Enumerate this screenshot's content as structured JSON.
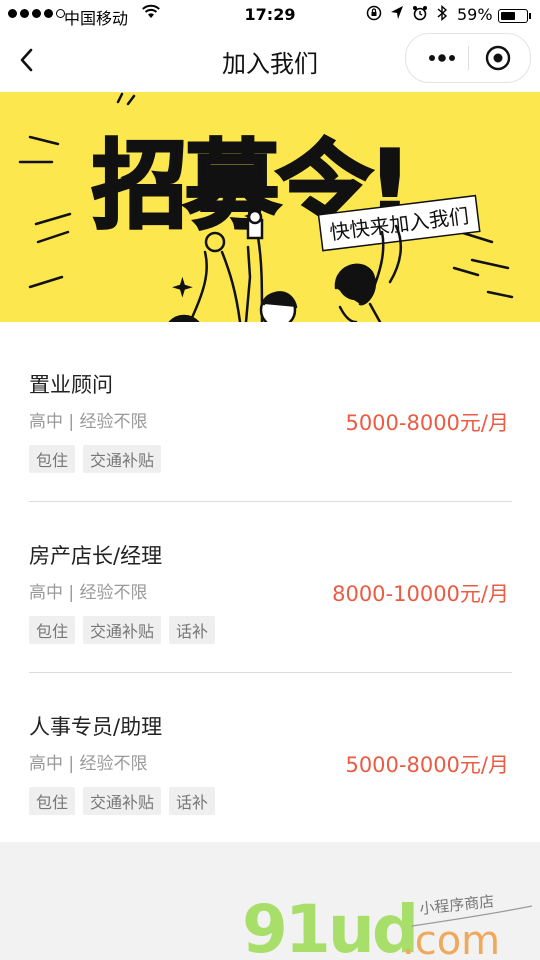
{
  "status_bar": {
    "carrier": "中国移动",
    "time": "17:29",
    "battery": "59%",
    "battery_level": 0.59
  },
  "nav": {
    "title": "加入我们"
  },
  "banner": {
    "headline": "招募令!",
    "subtitle": "快快来加入我们",
    "background": "#fde74e"
  },
  "jobs": [
    {
      "title": "置业顾问",
      "requirements": "高中 | 经验不限",
      "salary": "5000-8000元/月",
      "tags": [
        "包住",
        "交通补贴"
      ]
    },
    {
      "title": "房产店长/经理",
      "requirements": "高中 | 经验不限",
      "salary": "8000-10000元/月",
      "tags": [
        "包住",
        "交通补贴",
        "话补"
      ]
    },
    {
      "title": "人事专员/助理",
      "requirements": "高中 | 经验不限",
      "salary": "5000-8000元/月",
      "tags": [
        "包住",
        "交通补贴",
        "话补"
      ]
    }
  ],
  "watermark": {
    "brand": "91ud",
    "domain": ".com",
    "tagline": "小程序商店"
  },
  "colors": {
    "salary": "#ec5b43",
    "banner": "#fde74e"
  }
}
